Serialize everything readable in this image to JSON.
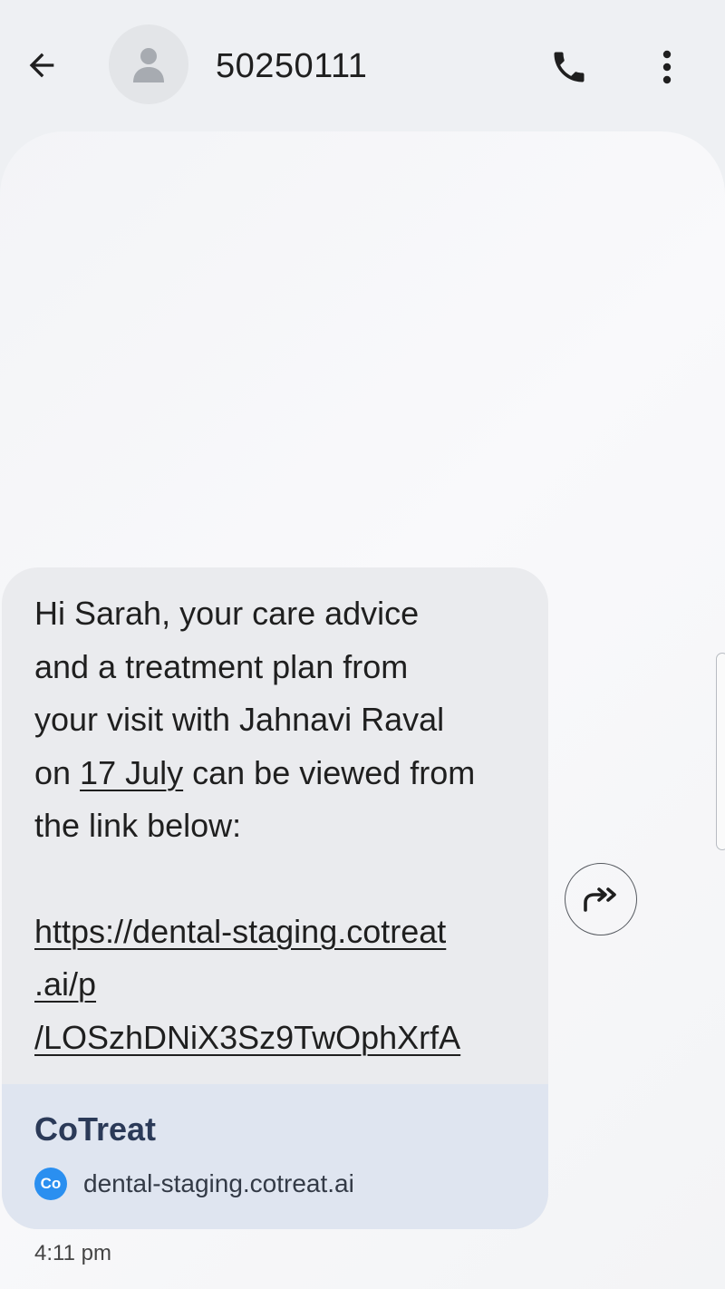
{
  "header": {
    "contact": "50250111",
    "back_icon": "arrow-back-icon",
    "avatar_icon": "person-icon",
    "call_icon": "phone-icon",
    "more_icon": "more-vert-icon"
  },
  "message": {
    "lines": [
      "Hi Sarah, your care advice",
      "and a treatment plan from",
      "your visit with Jahnavi Raval"
    ],
    "line4_prefix": "on ",
    "line4_date": "17 July",
    "line4_suffix": " can be viewed from",
    "line5": "the link below:",
    "link_lines": [
      "https://dental-staging.cotreat",
      ".ai/p",
      "/LOSzhDNiX3Sz9TwOphXrfA"
    ],
    "timestamp": "4:11 pm"
  },
  "link_preview": {
    "title": "CoTreat",
    "favicon_text": "Co",
    "domain": "dental-staging.cotreat.ai"
  },
  "actions": {
    "forward_icon": "forward-icon"
  },
  "colors": {
    "background": "#eef0f3",
    "bubble": "#eaebee",
    "preview": "#dfe5f0",
    "favicon": "#2a8ff0"
  }
}
